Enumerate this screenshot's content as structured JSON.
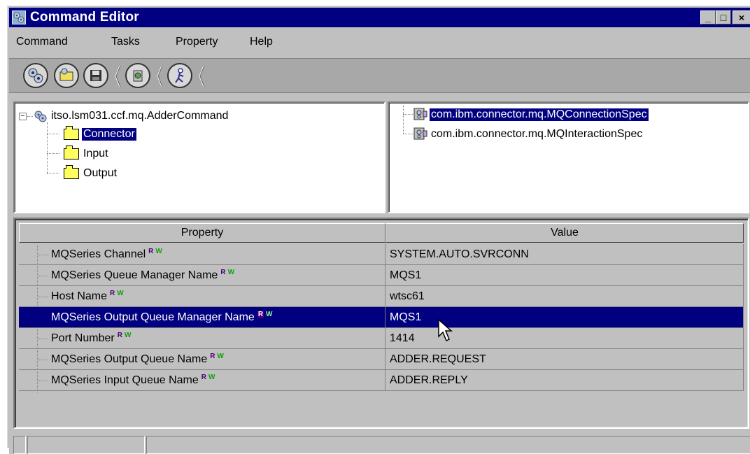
{
  "window": {
    "title": "Command Editor",
    "minimize": "_",
    "maximize": "□",
    "close": "×"
  },
  "menu": [
    "Command",
    "Tasks",
    "Property",
    "Help"
  ],
  "toolbar": {
    "buttons": [
      "gears-icon",
      "open-icon",
      "save-icon",
      "execute-icon",
      "run-man-icon"
    ]
  },
  "tree": {
    "root": "itso.lsm031.ccf.mq.AdderCommand",
    "expander": "−",
    "children": [
      "Connector",
      "Input",
      "Output"
    ],
    "selected": "Connector"
  },
  "specs": {
    "items": [
      "com.ibm.connector.mq.MQConnectionSpec",
      "com.ibm.connector.mq.MQInteractionSpec"
    ],
    "selected": "com.ibm.connector.mq.MQConnectionSpec"
  },
  "properties": {
    "headers": {
      "property": "Property",
      "value": "Value"
    },
    "badge_r": "R",
    "badge_w": "W",
    "rows": [
      {
        "name": "MQSeries Channel",
        "value": "SYSTEM.AUTO.SVRCONN"
      },
      {
        "name": "MQSeries Queue Manager Name",
        "value": "MQS1"
      },
      {
        "name": "Host Name",
        "value": "wtsc61"
      },
      {
        "name": "MQSeries Output Queue Manager Name",
        "value": "MQS1"
      },
      {
        "name": "Port Number",
        "value": "1414"
      },
      {
        "name": "MQSeries Output Queue Name",
        "value": "ADDER.REQUEST"
      },
      {
        "name": "MQSeries Input Queue Name",
        "value": "ADDER.REPLY"
      }
    ],
    "selected_row": "MQSeries Output Queue Manager Name"
  },
  "colors": {
    "selection": "#000080",
    "face": "#c0c0c0"
  }
}
